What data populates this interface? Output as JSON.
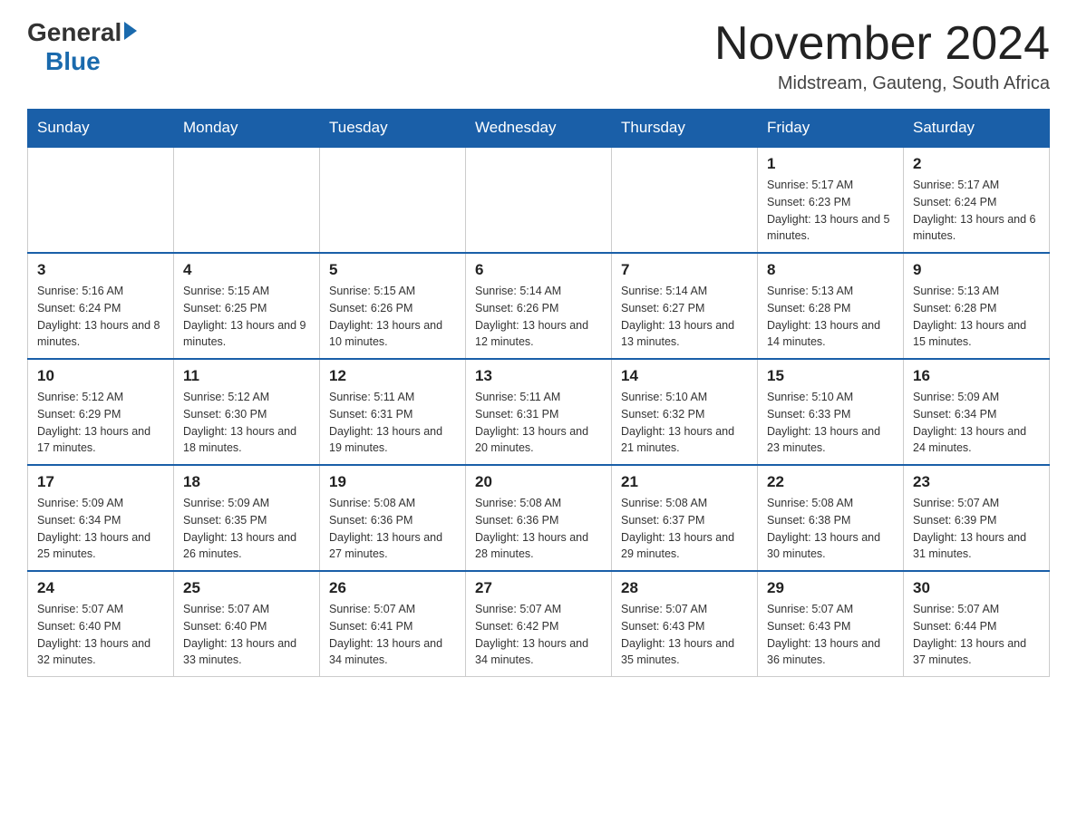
{
  "logo": {
    "general": "General",
    "blue": "Blue"
  },
  "header": {
    "month_year": "November 2024",
    "location": "Midstream, Gauteng, South Africa"
  },
  "days_of_week": [
    "Sunday",
    "Monday",
    "Tuesday",
    "Wednesday",
    "Thursday",
    "Friday",
    "Saturday"
  ],
  "weeks": [
    {
      "days": [
        {
          "number": "",
          "info": ""
        },
        {
          "number": "",
          "info": ""
        },
        {
          "number": "",
          "info": ""
        },
        {
          "number": "",
          "info": ""
        },
        {
          "number": "",
          "info": ""
        },
        {
          "number": "1",
          "info": "Sunrise: 5:17 AM\nSunset: 6:23 PM\nDaylight: 13 hours and 5 minutes."
        },
        {
          "number": "2",
          "info": "Sunrise: 5:17 AM\nSunset: 6:24 PM\nDaylight: 13 hours and 6 minutes."
        }
      ]
    },
    {
      "days": [
        {
          "number": "3",
          "info": "Sunrise: 5:16 AM\nSunset: 6:24 PM\nDaylight: 13 hours and 8 minutes."
        },
        {
          "number": "4",
          "info": "Sunrise: 5:15 AM\nSunset: 6:25 PM\nDaylight: 13 hours and 9 minutes."
        },
        {
          "number": "5",
          "info": "Sunrise: 5:15 AM\nSunset: 6:26 PM\nDaylight: 13 hours and 10 minutes."
        },
        {
          "number": "6",
          "info": "Sunrise: 5:14 AM\nSunset: 6:26 PM\nDaylight: 13 hours and 12 minutes."
        },
        {
          "number": "7",
          "info": "Sunrise: 5:14 AM\nSunset: 6:27 PM\nDaylight: 13 hours and 13 minutes."
        },
        {
          "number": "8",
          "info": "Sunrise: 5:13 AM\nSunset: 6:28 PM\nDaylight: 13 hours and 14 minutes."
        },
        {
          "number": "9",
          "info": "Sunrise: 5:13 AM\nSunset: 6:28 PM\nDaylight: 13 hours and 15 minutes."
        }
      ]
    },
    {
      "days": [
        {
          "number": "10",
          "info": "Sunrise: 5:12 AM\nSunset: 6:29 PM\nDaylight: 13 hours and 17 minutes."
        },
        {
          "number": "11",
          "info": "Sunrise: 5:12 AM\nSunset: 6:30 PM\nDaylight: 13 hours and 18 minutes."
        },
        {
          "number": "12",
          "info": "Sunrise: 5:11 AM\nSunset: 6:31 PM\nDaylight: 13 hours and 19 minutes."
        },
        {
          "number": "13",
          "info": "Sunrise: 5:11 AM\nSunset: 6:31 PM\nDaylight: 13 hours and 20 minutes."
        },
        {
          "number": "14",
          "info": "Sunrise: 5:10 AM\nSunset: 6:32 PM\nDaylight: 13 hours and 21 minutes."
        },
        {
          "number": "15",
          "info": "Sunrise: 5:10 AM\nSunset: 6:33 PM\nDaylight: 13 hours and 23 minutes."
        },
        {
          "number": "16",
          "info": "Sunrise: 5:09 AM\nSunset: 6:34 PM\nDaylight: 13 hours and 24 minutes."
        }
      ]
    },
    {
      "days": [
        {
          "number": "17",
          "info": "Sunrise: 5:09 AM\nSunset: 6:34 PM\nDaylight: 13 hours and 25 minutes."
        },
        {
          "number": "18",
          "info": "Sunrise: 5:09 AM\nSunset: 6:35 PM\nDaylight: 13 hours and 26 minutes."
        },
        {
          "number": "19",
          "info": "Sunrise: 5:08 AM\nSunset: 6:36 PM\nDaylight: 13 hours and 27 minutes."
        },
        {
          "number": "20",
          "info": "Sunrise: 5:08 AM\nSunset: 6:36 PM\nDaylight: 13 hours and 28 minutes."
        },
        {
          "number": "21",
          "info": "Sunrise: 5:08 AM\nSunset: 6:37 PM\nDaylight: 13 hours and 29 minutes."
        },
        {
          "number": "22",
          "info": "Sunrise: 5:08 AM\nSunset: 6:38 PM\nDaylight: 13 hours and 30 minutes."
        },
        {
          "number": "23",
          "info": "Sunrise: 5:07 AM\nSunset: 6:39 PM\nDaylight: 13 hours and 31 minutes."
        }
      ]
    },
    {
      "days": [
        {
          "number": "24",
          "info": "Sunrise: 5:07 AM\nSunset: 6:40 PM\nDaylight: 13 hours and 32 minutes."
        },
        {
          "number": "25",
          "info": "Sunrise: 5:07 AM\nSunset: 6:40 PM\nDaylight: 13 hours and 33 minutes."
        },
        {
          "number": "26",
          "info": "Sunrise: 5:07 AM\nSunset: 6:41 PM\nDaylight: 13 hours and 34 minutes."
        },
        {
          "number": "27",
          "info": "Sunrise: 5:07 AM\nSunset: 6:42 PM\nDaylight: 13 hours and 34 minutes."
        },
        {
          "number": "28",
          "info": "Sunrise: 5:07 AM\nSunset: 6:43 PM\nDaylight: 13 hours and 35 minutes."
        },
        {
          "number": "29",
          "info": "Sunrise: 5:07 AM\nSunset: 6:43 PM\nDaylight: 13 hours and 36 minutes."
        },
        {
          "number": "30",
          "info": "Sunrise: 5:07 AM\nSunset: 6:44 PM\nDaylight: 13 hours and 37 minutes."
        }
      ]
    }
  ]
}
